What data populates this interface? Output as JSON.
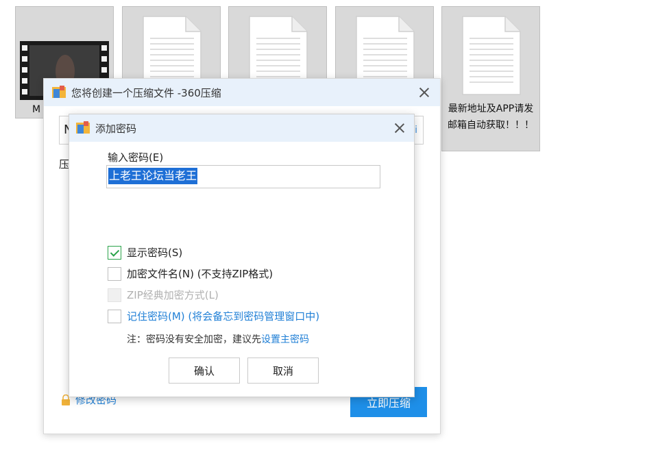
{
  "desktop": {
    "files": [
      {
        "label": "M",
        "icon": "video-film-icon"
      },
      {
        "label": "",
        "icon": "document-icon"
      },
      {
        "label": "",
        "icon": "document-icon"
      },
      {
        "label": "",
        "icon": "document-icon"
      },
      {
        "label": "最新地址及APP请发邮箱自动获取！！！",
        "icon": "document-icon"
      }
    ]
  },
  "outer_window": {
    "title": "您将创建一个压缩文件 -360压缩",
    "path_value": "N",
    "path_hint": "i",
    "section_label": "压",
    "modify_password_link": "修改密码",
    "compress_button": "立即压缩"
  },
  "password_dialog": {
    "title": "添加密码",
    "input_label": "输入密码(E)",
    "password_value": "上老王论坛当老王",
    "options": [
      {
        "label": "显示密码(S)",
        "checked": true,
        "enabled": true
      },
      {
        "label": "加密文件名(N) (不支持ZIP格式)",
        "checked": false,
        "enabled": true
      },
      {
        "label": "ZIP经典加密方式(L)",
        "checked": false,
        "enabled": false
      },
      {
        "label": "记住密码(M) (将会备忘到密码管理窗口中)",
        "checked": false,
        "enabled": true
      }
    ],
    "note_prefix": "注：密码没有安全加密，建议先",
    "note_link": "设置主密码",
    "ok_button": "确认",
    "cancel_button": "取消"
  },
  "colors": {
    "title_bar": "#e8f1fb",
    "accent_blue": "#1e8fe8",
    "link_blue": "#1f7fd6",
    "selection_blue": "#1e6fd6",
    "check_green": "#2aa34a"
  }
}
